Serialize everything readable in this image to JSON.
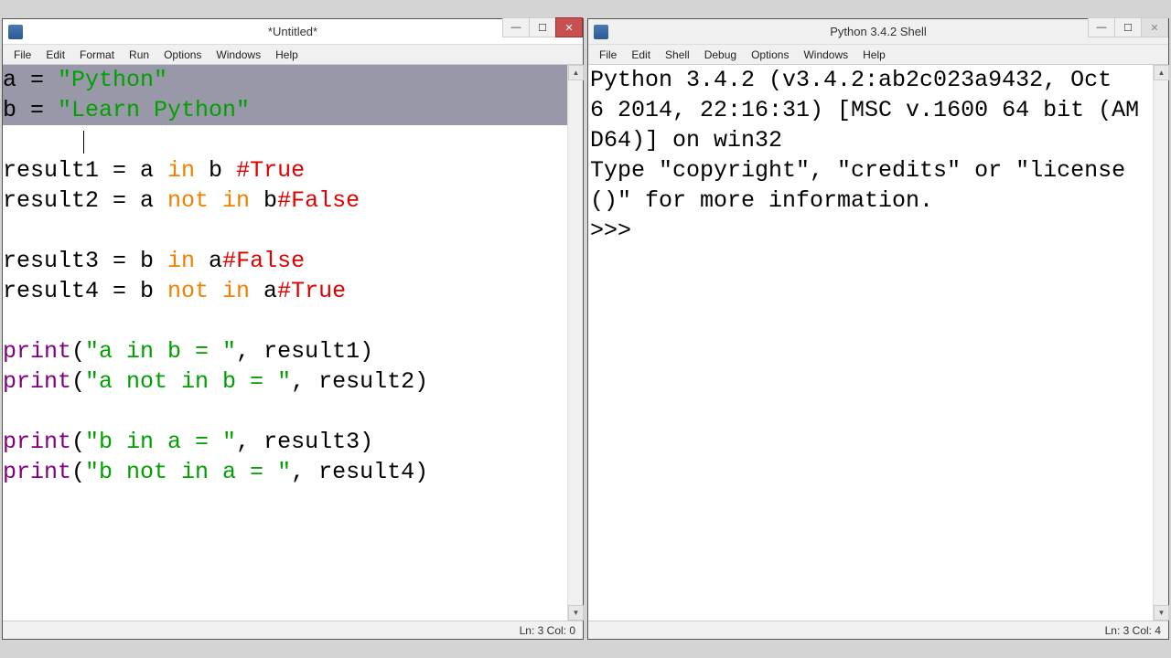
{
  "editor": {
    "title": "*Untitled*",
    "menus": [
      "File",
      "Edit",
      "Format",
      "Run",
      "Options",
      "Windows",
      "Help"
    ],
    "status": "Ln: 3 Col: 0",
    "lines": {
      "l1_a": "a = ",
      "l1_b": "\"Python\"",
      "l2_a": "b = ",
      "l2_b": "\"Learn Python\"",
      "l4_a": "result1 = a ",
      "l4_kw": "in",
      "l4_b": " b ",
      "l4_cmt": "#True",
      "l5_a": "result2 = a ",
      "l5_kw": "not in",
      "l5_b": " b",
      "l5_cmt": "#False",
      "l7_a": "result3 = b ",
      "l7_kw": "in",
      "l7_b": " a",
      "l7_cmt": "#False",
      "l8_a": "result4 = b ",
      "l8_kw": "not in",
      "l8_b": " a",
      "l8_cmt": "#True",
      "l10_fn": "print",
      "l10_a": "(",
      "l10_str": "\"a in b = \"",
      "l10_b": ", result1)",
      "l11_fn": "print",
      "l11_a": "(",
      "l11_str": "\"a not in b = \"",
      "l11_b": ", result2)",
      "l13_fn": "print",
      "l13_a": "(",
      "l13_str": "\"b in a = \"",
      "l13_b": ", result3)",
      "l14_fn": "print",
      "l14_a": "(",
      "l14_str": "\"b not in a = \"",
      "l14_b": ", result4)"
    }
  },
  "shell": {
    "title": "Python 3.4.2 Shell",
    "menus": [
      "File",
      "Edit",
      "Shell",
      "Debug",
      "Options",
      "Windows",
      "Help"
    ],
    "status": "Ln: 3 Col: 4",
    "banner": "Python 3.4.2 (v3.4.2:ab2c023a9432, Oct  6 2014, 22:16:31) [MSC v.1600 64 bit (AMD64)] on win32\nType \"copyright\", \"credits\" or \"license()\" for more information.",
    "prompt": ">>> "
  },
  "win": {
    "min": "—",
    "max": "☐",
    "close": "✕"
  }
}
